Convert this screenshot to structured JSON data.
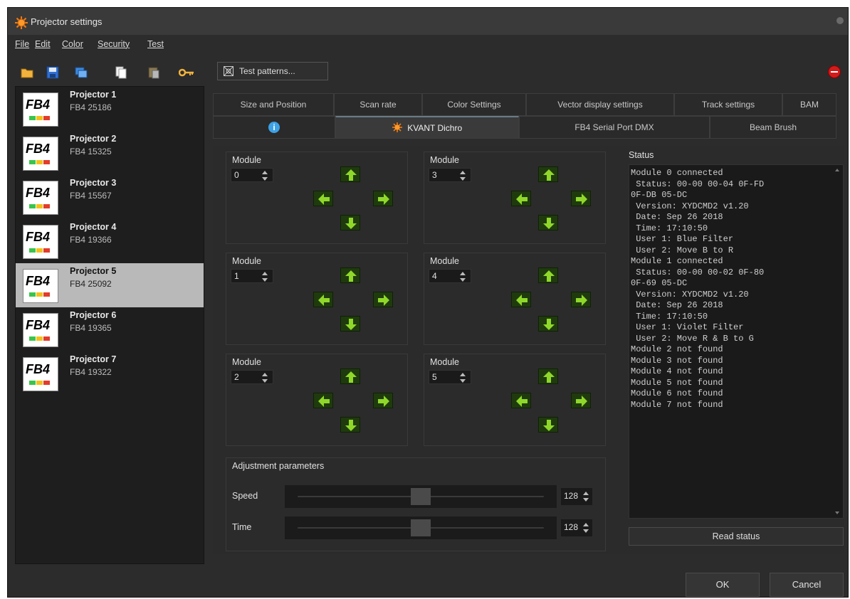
{
  "window": {
    "title": "Projector settings"
  },
  "menu": [
    "File",
    "Edit",
    "Color",
    "Security",
    "Test"
  ],
  "toolbar": {
    "icons": [
      "open-folder-icon",
      "save-icon",
      "network-icon",
      "copy-icon",
      "paste-icon",
      "key-icon"
    ],
    "test_patterns_label": "Test patterns..."
  },
  "projectors": [
    {
      "name": "Projector 1",
      "serial": "FB4 25186",
      "logo": "FB4"
    },
    {
      "name": "Projector 2",
      "serial": "FB4 15325",
      "logo": "FB4"
    },
    {
      "name": "Projector 3",
      "serial": "FB4 15567",
      "logo": "FB4"
    },
    {
      "name": "Projector 4",
      "serial": "FB4 19366",
      "logo": "FB4"
    },
    {
      "name": "Projector 5",
      "serial": "FB4 25092",
      "logo": "FB4",
      "selected": true
    },
    {
      "name": "Projector 6",
      "serial": "FB4 19365",
      "logo": "FB4"
    },
    {
      "name": "Projector 7",
      "serial": "FB4 19322",
      "logo": "FB4"
    }
  ],
  "tabs_row1": [
    "Size and Position",
    "Scan rate",
    "Color Settings",
    "Vector display settings",
    "Track settings",
    "BAM"
  ],
  "tabs_row2": [
    "",
    "KVANT Dichro",
    "FB4 Serial Port DMX",
    "Beam Brush"
  ],
  "active_tab": "KVANT Dichro",
  "modules": [
    {
      "label": "Module",
      "value": "0"
    },
    {
      "label": "Module",
      "value": "3"
    },
    {
      "label": "Module",
      "value": "1"
    },
    {
      "label": "Module",
      "value": "4"
    },
    {
      "label": "Module",
      "value": "2"
    },
    {
      "label": "Module",
      "value": "5"
    }
  ],
  "adjustment": {
    "title": "Adjustment parameters",
    "speed": {
      "label": "Speed",
      "value": "128",
      "level": 0.5
    },
    "time": {
      "label": "Time",
      "value": "128",
      "level": 0.5
    }
  },
  "status": {
    "title": "Status",
    "lines": [
      "Module 0 connected",
      " Status: 00-00 00-04 0F-FD",
      "0F-DB 05-DC",
      " Version: XYDCMD2 v1.20",
      " Date: Sep 26 2018",
      " Time: 17:10:50",
      " User 1: Blue Filter",
      " User 2: Move B to R",
      "Module 1 connected",
      " Status: 00-00 00-02 0F-80",
      "0F-69 05-DC",
      " Version: XYDCMD2 v1.20",
      " Date: Sep 26 2018",
      " Time: 17:10:50",
      " User 1: Violet Filter",
      " User 2: Move R & B to G",
      "Module 2 not found",
      "Module 3 not found",
      "Module 4 not found",
      "Module 5 not found",
      "Module 6 not found",
      "Module 7 not found"
    ],
    "read_button": "Read status"
  },
  "buttons": {
    "ok": "OK",
    "cancel": "Cancel"
  },
  "colors": {
    "arrow_green": "#8fd82a",
    "accent_orange": "#f07b14",
    "stop_red": "#d21b1b",
    "info_blue": "#3da1e6"
  }
}
